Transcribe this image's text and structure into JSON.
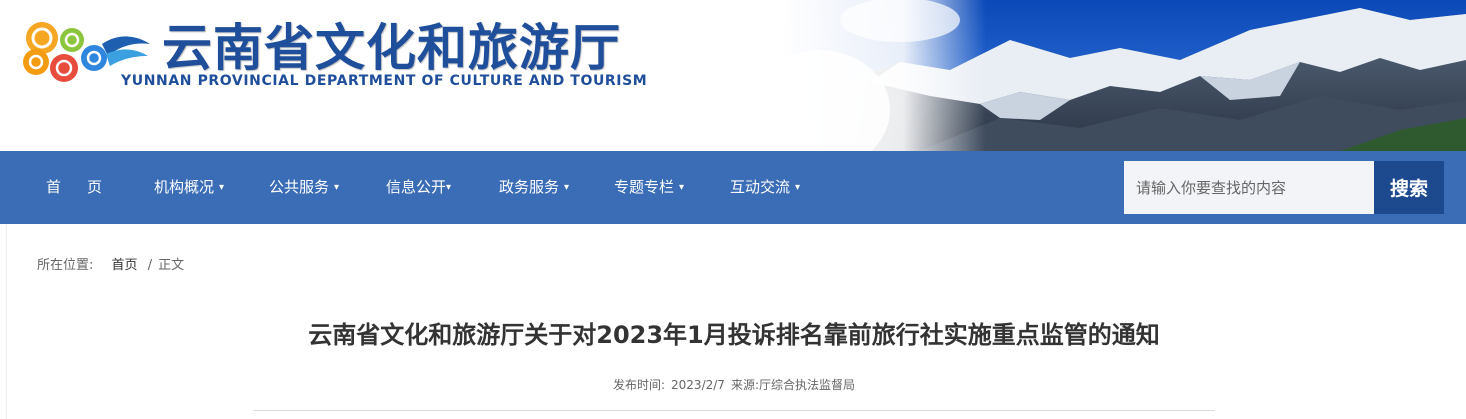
{
  "header": {
    "title": "云南省文化和旅游厅",
    "subtitle": "YUNNAN PROVINCIAL DEPARTMENT OF CULTURE AND TOURISM",
    "logo_icon": "auspicious-cloud-logo-icon",
    "banner_image": "snow-mountain-landscape"
  },
  "nav": {
    "items": [
      {
        "label": "首页",
        "has_dropdown": false
      },
      {
        "label": "机构概况",
        "has_dropdown": true
      },
      {
        "label": "公共服务",
        "has_dropdown": true
      },
      {
        "label": "信息公开",
        "has_dropdown": true
      },
      {
        "label": "政务服务",
        "has_dropdown": true
      },
      {
        "label": "专题专栏",
        "has_dropdown": true
      },
      {
        "label": "互动交流",
        "has_dropdown": true
      }
    ],
    "caret": "▾"
  },
  "search": {
    "placeholder": "请输入你要查找的内容",
    "button_label": "搜索"
  },
  "breadcrumb": {
    "prefix": "所在位置:",
    "home": "首页",
    "separator": "/",
    "current": "正文"
  },
  "article": {
    "title": "云南省文化和旅游厅关于对2023年1月投诉排名靠前旅行社实施重点监管的通知",
    "publish_label": "发布时间:",
    "publish_date": "2023/2/7",
    "source_label": "来源:",
    "source": "厅综合执法监督局"
  },
  "colors": {
    "brand_blue": "#1f4e9a",
    "nav_bg": "#3a6db6",
    "search_button": "#1d4a8f"
  }
}
